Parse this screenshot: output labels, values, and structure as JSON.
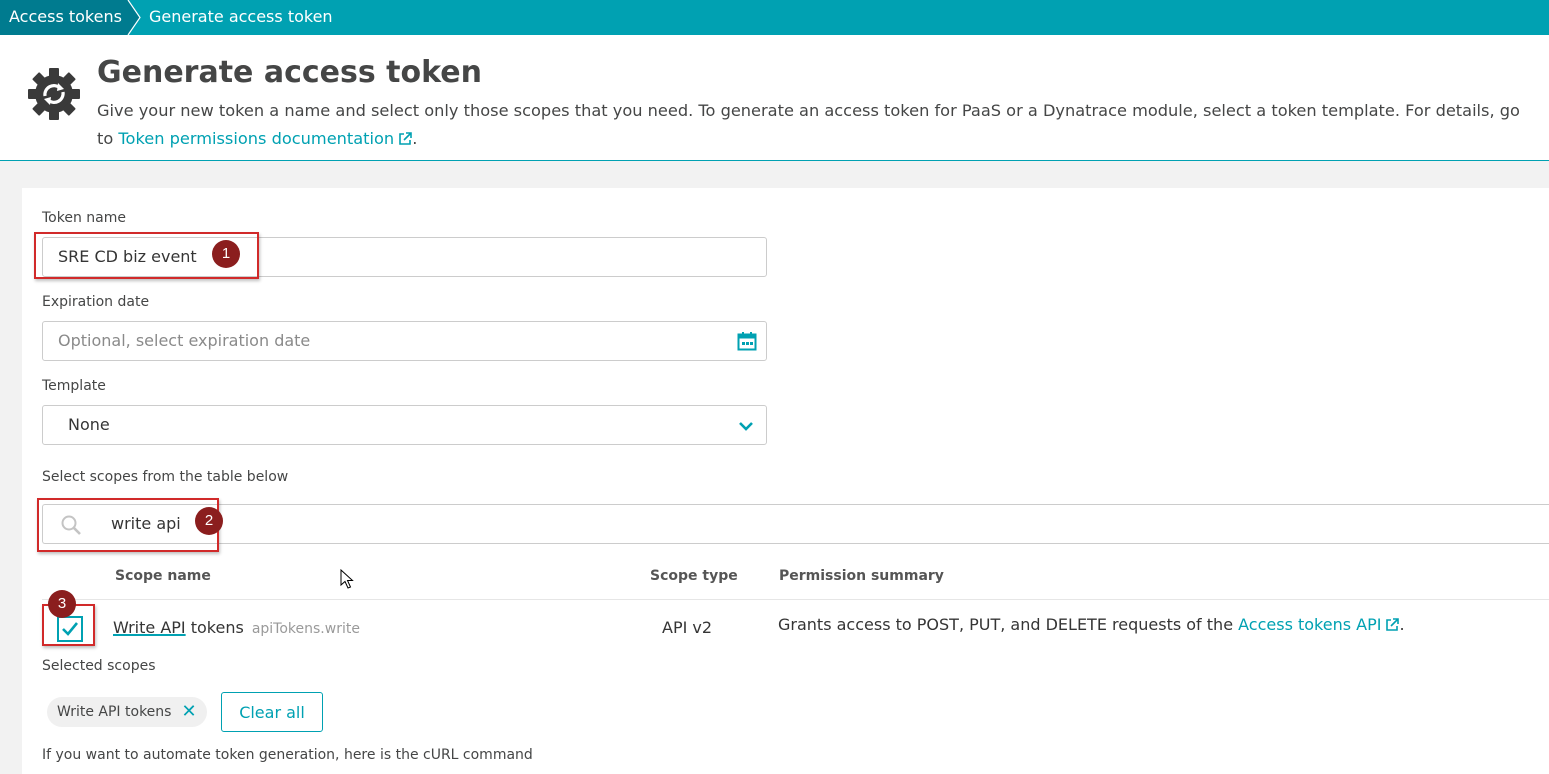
{
  "breadcrumb": {
    "items": [
      "Access tokens",
      "Generate access token"
    ]
  },
  "header": {
    "title": "Generate access token",
    "description": "Give your new token a name and select only those scopes that you need. To generate an access token for PaaS or a Dynatrace module, select a token template. For details, go to ",
    "doc_link": "Token permissions documentation",
    "description_end": "."
  },
  "form": {
    "token_name_label": "Token name",
    "token_name_value": "SRE CD biz event",
    "expiration_label": "Expiration date",
    "expiration_placeholder": "Optional, select expiration date",
    "template_label": "Template",
    "template_value": "None",
    "scopes_label": "Select scopes from the table below",
    "search_value": "write api"
  },
  "annotations": [
    "1",
    "2",
    "3"
  ],
  "scopes_table": {
    "headers": [
      "Scope name",
      "Scope type",
      "Permission summary"
    ],
    "rows": [
      {
        "name_highlight": "Write API",
        "name_rest": " tokens",
        "id": "apiTokens.write",
        "type": "API v2",
        "summary": "Grants access to POST, PUT, and DELETE requests of the ",
        "summary_link": "Access tokens API",
        "summary_end": ".",
        "checked": true
      }
    ]
  },
  "selected": {
    "label": "Selected scopes",
    "chips": [
      "Write API tokens"
    ],
    "clear_label": "Clear all"
  },
  "footer_text": "If you want to automate token generation, here is the cURL command",
  "colors": {
    "accent": "#00a1b2",
    "breadcrumb_dark": "#007b8f",
    "annotation_box": "#d12a2a",
    "annotation_badge": "#8b1e1e"
  }
}
